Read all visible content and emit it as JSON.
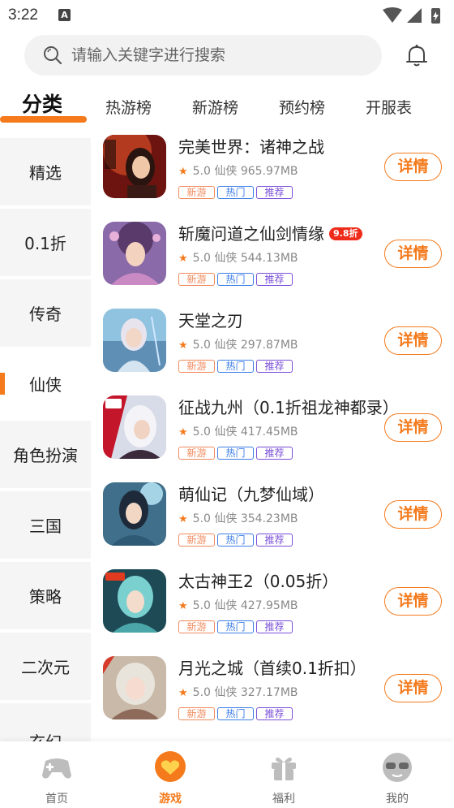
{
  "status_bar": {
    "time": "3:22",
    "notification_glyph": "A"
  },
  "search": {
    "placeholder": "请输入关键字进行搜索"
  },
  "tabs": [
    {
      "label": "分类",
      "active": true
    },
    {
      "label": "热游榜"
    },
    {
      "label": "新游榜"
    },
    {
      "label": "预约榜"
    },
    {
      "label": "开服表"
    }
  ],
  "categories": [
    {
      "label": "精选"
    },
    {
      "label": "0.1折"
    },
    {
      "label": "传奇"
    },
    {
      "label": "仙侠",
      "active": true
    },
    {
      "label": "角色扮演"
    },
    {
      "label": "三国"
    },
    {
      "label": "策略"
    },
    {
      "label": "二次元"
    },
    {
      "label": "玄幻"
    }
  ],
  "games": [
    {
      "name": "完美世界：诸神之战",
      "discount": "",
      "rating": "5.0",
      "genre": "仙侠",
      "size": "965.97MB"
    },
    {
      "name": "斩魔问道之仙剑情缘",
      "discount": "9.8折",
      "rating": "5.0",
      "genre": "仙侠",
      "size": "544.13MB"
    },
    {
      "name": "天堂之刃",
      "discount": "",
      "rating": "5.0",
      "genre": "仙侠",
      "size": "297.87MB"
    },
    {
      "name": "征战九州（0.1折祖龙神都录）",
      "discount": "",
      "rating": "5.0",
      "genre": "仙侠",
      "size": "417.45MB"
    },
    {
      "name": "萌仙记（九梦仙域）",
      "discount": "",
      "rating": "5.0",
      "genre": "仙侠",
      "size": "354.23MB"
    },
    {
      "name": "太古神王2（0.05折）",
      "discount": "",
      "rating": "5.0",
      "genre": "仙侠",
      "size": "427.95MB"
    },
    {
      "name": "月光之城（首续0.1折扣）",
      "discount": "",
      "rating": "5.0",
      "genre": "仙侠",
      "size": "327.17MB"
    }
  ],
  "tag_labels": {
    "new": "新游",
    "hot": "热门",
    "recommend": "推荐"
  },
  "detail_label": "详情",
  "bottom_nav": [
    {
      "label": "首页",
      "icon": "gamepad-icon"
    },
    {
      "label": "游戏",
      "icon": "heart-chat-icon",
      "active": true
    },
    {
      "label": "福利",
      "icon": "gift-icon"
    },
    {
      "label": "我的",
      "icon": "profile-face-icon"
    }
  ],
  "colors": {
    "accent": "#f47a1c",
    "discount_badge": "#ef2b1a",
    "tag_new": "#f08a5d",
    "tag_hot": "#3d7ee6",
    "tag_recommend": "#7a4fd8"
  }
}
